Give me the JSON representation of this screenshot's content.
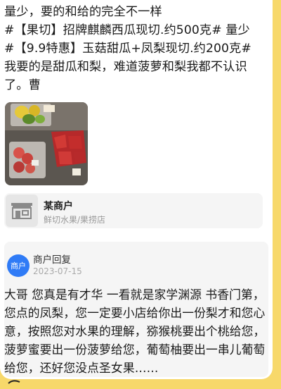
{
  "review": {
    "line1": "量少，要的和给的完全不一样",
    "line2": "#【果切】招牌麒麟西瓜现切.约500克# 量少",
    "line3": "#【9.9特惠】玉菇甜瓜+凤梨现切.约200克#",
    "line4": "我要的是甜瓜和梨，难道菠萝和梨我都不认识",
    "line5": "了。曹"
  },
  "photos": [
    {
      "icon": "fruit-cut-photo-icon"
    }
  ],
  "store": {
    "name": "某商户",
    "category": "鲜切水果/果捞店",
    "icon": "storefront-icon"
  },
  "merchant_reply": {
    "avatar_label": "商户",
    "title": "商户回复",
    "date": "2023-07-15",
    "text": "大哥 您真是有才华 一看就是家学渊源 书香门第，您点的凤梨，您一定要小店给你出一份梨才和您心意，按照您对水果的理解，猕猴桃要出个桃给您，菠萝蜜要出一份菠萝给您，葡萄柚要出一串儿葡萄给您，还好您没点圣女果……"
  },
  "colors": {
    "background": "#f7d86a",
    "card": "#ffffff",
    "reply_bg": "#f5f5f5",
    "avatar": "#2f7bf6"
  }
}
